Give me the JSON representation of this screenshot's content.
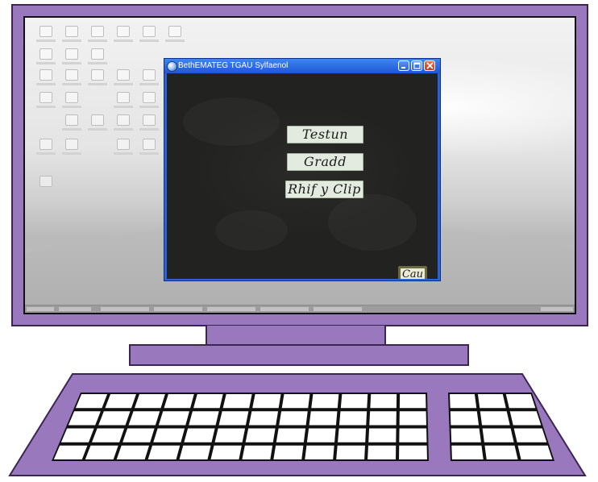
{
  "window": {
    "title": "BethEMATEG TGAU Sylfaenol",
    "icon": "app-globe-icon"
  },
  "menu": {
    "testun": "Testun",
    "gradd": "Gradd",
    "rhif_y_clip": "Rhif y Clip",
    "cau": "Cau"
  },
  "colors": {
    "monitor_frame": "#9a78bd",
    "frame_outline": "#3b2652",
    "chalkboard": "#222220",
    "menu_button": "#e3ebe0",
    "titlebar": "#2b62d9",
    "close_button": "#c7391c"
  }
}
